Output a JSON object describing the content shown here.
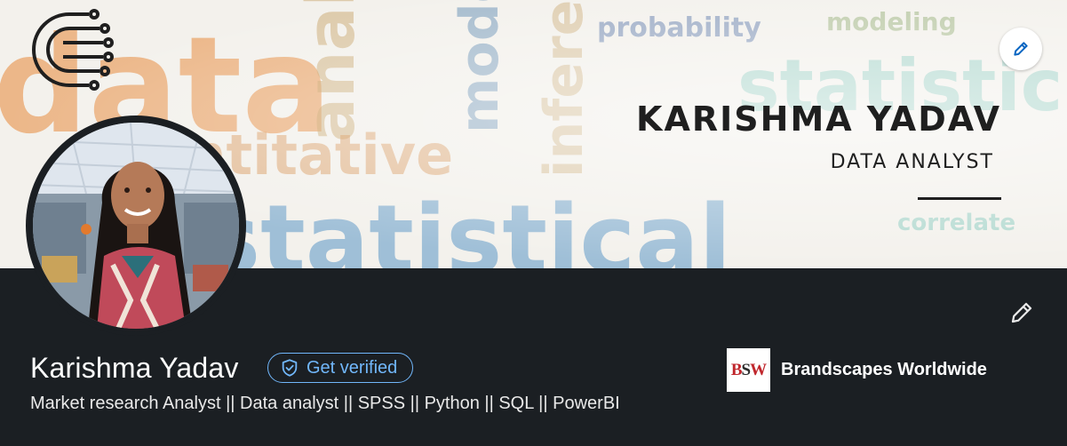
{
  "banner": {
    "title": "KARISHMA YADAV",
    "subtitle": "DATA ANALYST",
    "words": [
      "data",
      "analysis",
      "model",
      "probability",
      "modeling",
      "inference",
      "statistic",
      "quantitative",
      "statistical",
      "correlate"
    ]
  },
  "profile": {
    "name": "Karishma Yadav",
    "verify_label": "Get verified",
    "headline": "Market research Analyst || Data analyst || SPSS || Python || SQL || PowerBI"
  },
  "company": {
    "logo_text_b": "B",
    "logo_text_s": "S",
    "logo_text_w": "W",
    "name": "Brandscapes Worldwide"
  },
  "colors": {
    "background": "#1b1f23",
    "accent": "#71b7fb",
    "edit_icon_blue": "#0a66c2"
  },
  "icons": {
    "edit_cover": "pencil-icon",
    "edit_profile": "pencil-icon",
    "verify": "shield-check-icon",
    "logo": "circuit-c-logo"
  }
}
